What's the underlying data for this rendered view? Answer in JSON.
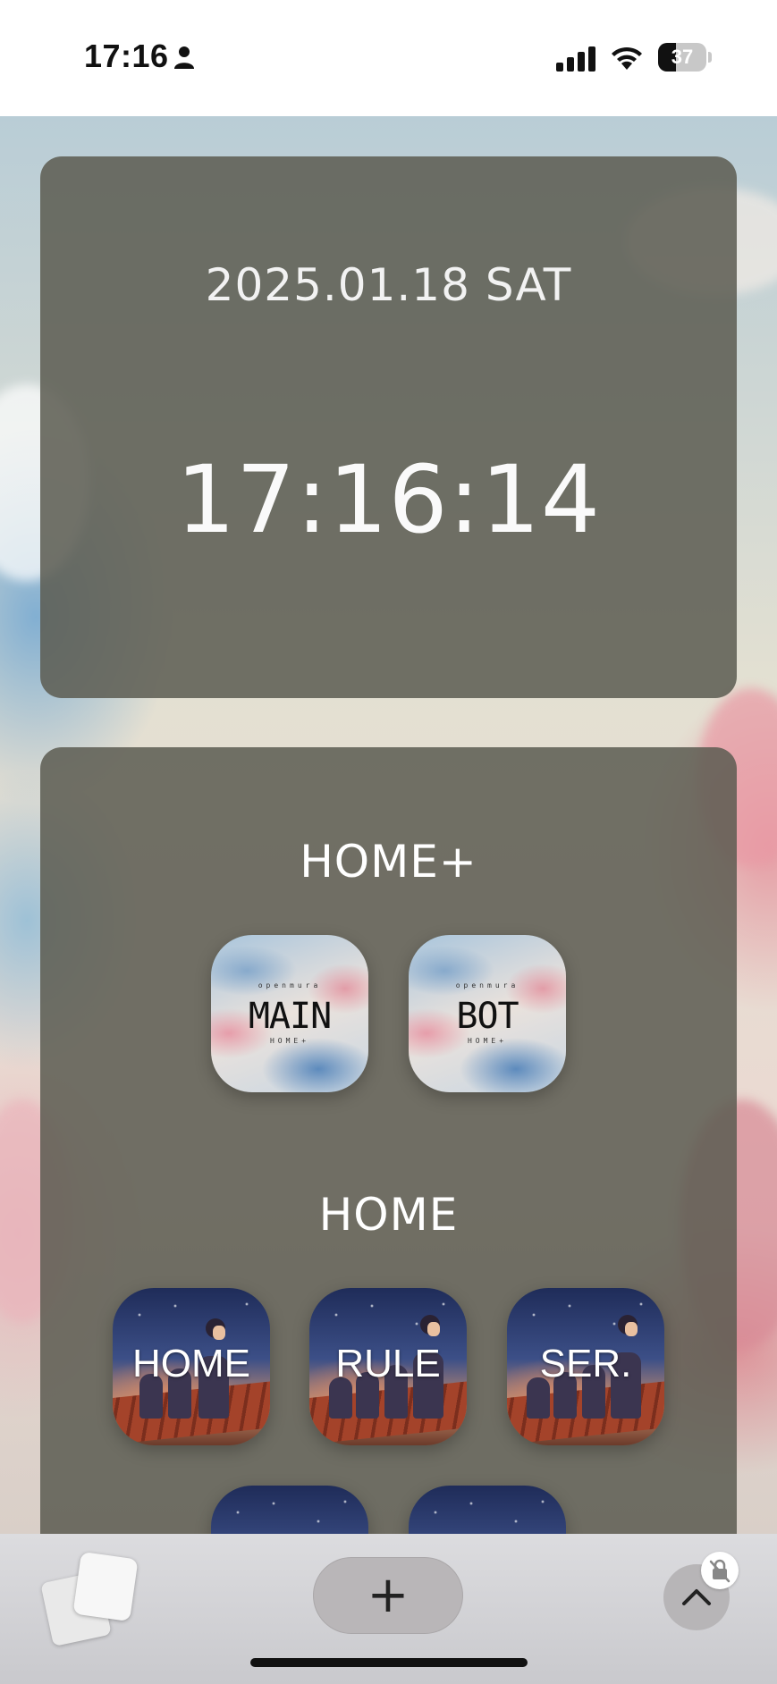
{
  "status_bar": {
    "time": "17:16",
    "battery_level": "37",
    "battery_fraction": 0.37,
    "icons": [
      "person-icon",
      "cellular-signal-icon",
      "wifi-icon",
      "battery-icon"
    ]
  },
  "clock_widget": {
    "date": "2025.01.18 SAT",
    "time": "17:16:14"
  },
  "app_sections": [
    {
      "title": "HOME+",
      "apps": [
        {
          "label": "MAIN",
          "top_text": "openmura",
          "sub_text": "HOME+"
        },
        {
          "label": "BOT",
          "top_text": "openmura",
          "sub_text": "HOME+"
        }
      ]
    },
    {
      "title": "HOME",
      "apps": [
        {
          "label": "HOME"
        },
        {
          "label": "RULE"
        },
        {
          "label": "SER."
        }
      ]
    }
  ],
  "toolbar": {
    "tabs_icon": "tabs-icon",
    "new_tab_label": "+",
    "scroll_up_icon": "chevron-up-icon",
    "lock_icon": "lock-slash-icon"
  },
  "colors": {
    "card_overlay": "#5c5c52",
    "toolbar": "#d2d2d5"
  }
}
